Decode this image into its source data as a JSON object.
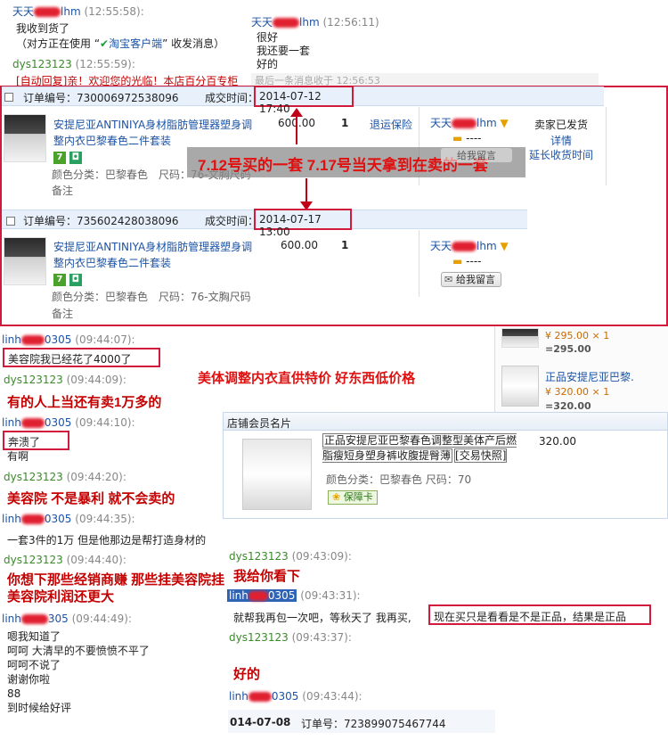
{
  "top_chat": {
    "m1_sender": "天天",
    "m1_sender_tail": "lhm",
    "m1_time": "(12:55:58):",
    "m1_text": "我收到货了",
    "m1_note_pre": "（对方正在使用 “",
    "m1_note_app": "淘宝客户端",
    "m1_note_post": "” 收发消息）",
    "m2_sender": "dys123123",
    "m2_time": "(12:55:59):",
    "m2_text": "[自动回复]亲！欢迎您的光临！本店百分百专柜",
    "popup": {
      "sender": "天天",
      "sender_tail": "lhm",
      "time": "(12:56:11)",
      "lines": [
        "很好",
        "我还要一套",
        "好的"
      ],
      "last_msg": "最后一条消息收于 12:56:53"
    }
  },
  "orders": [
    {
      "order_no_label": "订单编号：",
      "order_no": "730006972538096",
      "time_label": "成交时间：",
      "time": "2014-07-12 17:40",
      "title": "安提尼亚ANTINIYA身材脂肪管理器塑身调整内衣巴黎春色二件套装",
      "price": "600.00",
      "qty": "1",
      "refund": "退运保险",
      "buyer": "天天",
      "buyer_tail": "lhm",
      "rating_label": "----",
      "msg_label": "给我留言",
      "attr_color": "颜色分类：巴黎春色",
      "attr_size": "尺码：76-文胸尺码",
      "note": "备注",
      "status": "卖家已发货",
      "detail": "详情",
      "extend": "延长收货时间"
    },
    {
      "order_no_label": "订单编号：",
      "order_no": "735602428038096",
      "time_label": "成交时间：",
      "time": "2014-07-17 13:00",
      "title": "安提尼亚ANTINIYA身材脂肪管理器塑身调整内衣巴黎春色二件套装",
      "price": "600.00",
      "qty": "1",
      "buyer": "天天",
      "buyer_tail": "lhm",
      "rating_label": "----",
      "msg_label": "给我留言",
      "attr_color": "颜色分类：巴黎春色",
      "attr_size": "尺码：76-文胸尺码",
      "note": "备注"
    }
  ],
  "annotation_orders": "7.12号买的一套 7.17号当天拿到在卖的一套",
  "left_chat": [
    {
      "sender": "linh",
      "tail": "0305",
      "time": "(09:44:07):",
      "text": "美容院我已经花了4000了",
      "boxed": true
    },
    {
      "sender": "dys123123",
      "time": "(09:44:09):",
      "text": ""
    },
    {
      "sender": "linh",
      "tail": "0305",
      "time": "(09:44:10):",
      "text": "奔溃了",
      "boxed": true,
      "extra": "有啊"
    },
    {
      "sender": "dys123123",
      "time": "(09:44:20):",
      "text": ""
    },
    {
      "sender": "linh",
      "tail": "0305",
      "time": "(09:44:35):",
      "text": "一套3件的1万 但是他那边是帮打造身材的"
    },
    {
      "sender": "dys123123",
      "time": "(09:44:40):",
      "text": ""
    },
    {
      "sender": "linh",
      "tail": "305",
      "time": "(09:44:49):",
      "text": "嗯我知道了"
    }
  ],
  "left_tail_lines": [
    "呵呵 大清早的不要愤愤不平了",
    "呵呵不说了",
    "谢谢你啦",
    "88",
    "到时候给好评"
  ],
  "red_annotations": {
    "headline": "美体调整内衣直供特价 好东西低价格",
    "a1": "有的人上当还有卖1万多的",
    "a2": "美容院 不是暴利 就不会卖的",
    "a3": "你想下那些经销商赚 那些挂美容院挂美容院利润还更大",
    "a4": "我给你看下",
    "a5": "好的"
  },
  "side_products": [
    {
      "price_line": "¥ 295.00 × 1",
      "total": "=295.00"
    },
    {
      "title": "正品安提尼亚巴黎.",
      "price_line": "¥ 320.00 × 1",
      "total": "=320.00"
    }
  ],
  "card": {
    "header": "店铺会员名片",
    "title": "正品安提尼亚巴黎春色调整型美体产后燃脂瘦短身塑身裤收腹提臀薄",
    "snapshot": "[交易快照]",
    "price": "320.00",
    "attr": "颜色分类：巴黎春色  尺码：70",
    "badge": "保障卡"
  },
  "right_chat": {
    "s1": "dys123123",
    "t1": "(09:43:09):",
    "s2_head": "linh",
    "s2_tail": "0305",
    "t2": "(09:43:31):",
    "msg2_a": "就帮我再包一次吧，等秋天了 我再买,",
    "msg2_b": "现在买只是看看是不是正品，结果是正品",
    "s3": "dys123123",
    "t3": "(09:43:37):",
    "s4_head": "linh",
    "s4_tail": "0305",
    "t4": "(09:43:44):",
    "bottom_date": "014-07-08",
    "bottom_order_label": "订单号：",
    "bottom_order": "723899075467744"
  }
}
